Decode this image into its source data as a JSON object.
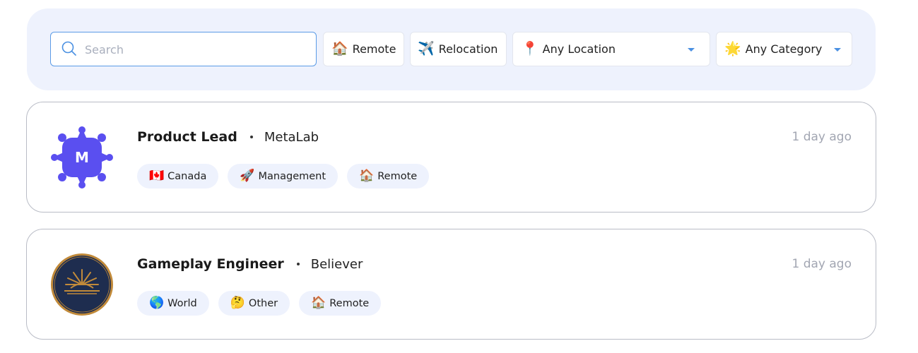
{
  "filters": {
    "search_placeholder": "Search",
    "remote": {
      "icon": "🏠",
      "label": "Remote"
    },
    "relocation": {
      "icon": "✈️",
      "label": "Relocation"
    },
    "location": {
      "icon": "📍",
      "label": "Any Location"
    },
    "category": {
      "icon": "🌟",
      "label": "Any Category"
    }
  },
  "jobs": [
    {
      "title": "Product Lead",
      "company": "MetaLab",
      "logo_letter": "M",
      "logo_color": "#5a4ff0",
      "posted": "1 day ago",
      "tags": [
        {
          "icon": "🇨🇦",
          "label": "Canada"
        },
        {
          "icon": "🚀",
          "label": "Management"
        },
        {
          "icon": "🏠",
          "label": "Remote"
        }
      ]
    },
    {
      "title": "Gameplay Engineer",
      "company": "Believer",
      "logo_color": "#1e2d4f",
      "posted": "1 day ago",
      "tags": [
        {
          "icon": "🌎",
          "label": "World"
        },
        {
          "icon": "🤔",
          "label": "Other"
        },
        {
          "icon": "🏠",
          "label": "Remote"
        }
      ]
    }
  ]
}
